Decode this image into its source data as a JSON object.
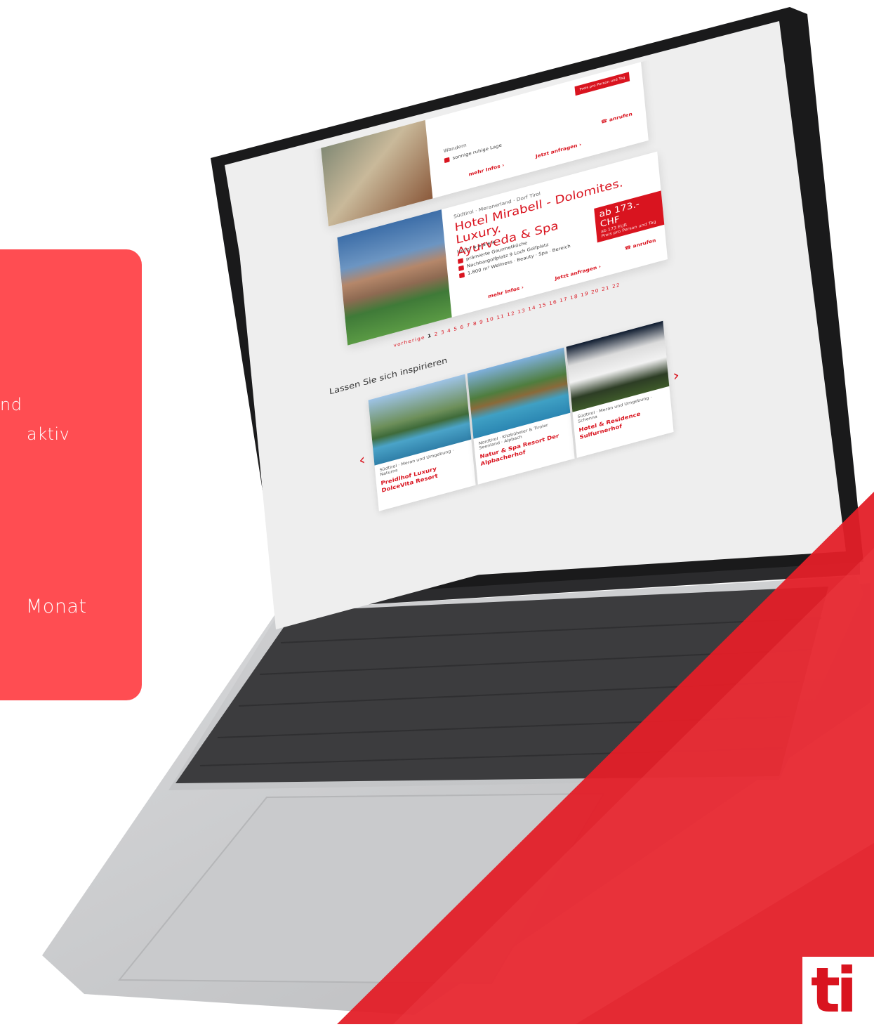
{
  "promo": {
    "line1": "nd",
    "line2": "aktiv",
    "line3": "Monat"
  },
  "laptop_screen": {
    "top_card": {
      "region_partial": "Wandern",
      "feature": "sonnige ruhige Lage",
      "price_note": "Preis pro Person und Tag",
      "more_link": "mehr Infos ›",
      "inquire_link": "Jetzt anfragen ›",
      "call_label": "anrufen"
    },
    "hotel_card": {
      "region": "Südtirol · Meranerland · Dorf Tirol",
      "title_line1": "Hotel Mirabell - Dolomites. Luxury.",
      "title_line2": "Ayurveda & Spa",
      "stars": "Hotel ★★★★★",
      "features": [
        "prämierte Gourmetküche",
        "Nachbargolfplatz 9 Loch Golfplatz",
        "1.800 m² Wellness · Beauty · Spa · Bereich"
      ],
      "price_main": "ab 173.- CHF",
      "price_sub": "ab 173 EUR",
      "price_note": "Preis pro Person und Tag",
      "more_link": "mehr Infos ›",
      "inquire_link": "Jetzt anfragen ›",
      "call_label": "anrufen"
    },
    "pagination": {
      "prev_label": "vorherige",
      "current": "1",
      "pages": "2 3 4 5 6 7 8 9 10 11 12 13 14 15 16 17 18 19 20 21 22"
    },
    "inspiration": {
      "title": "Lassen Sie sich inspirieren",
      "prev_arrow": "‹",
      "next_arrow": "›",
      "cards": [
        {
          "region": "Südtirol · Meran und Umgebung · Naturns",
          "name": "Preidlhof Luxury DolceVita Resort"
        },
        {
          "region": "Nordtirol · Kitzbüheler & Tiroler Seenland · Alpbach",
          "name": "Natur & Spa Resort Der Alpbacherhof"
        },
        {
          "region": "Südtirol · Meran und Umgebung · Schenna",
          "name": "Hotel & Residence Sulfurnerhof"
        }
      ]
    }
  },
  "logo": {
    "text": "ti"
  },
  "colors": {
    "brand_red": "#d9141f",
    "panel_red": "#ff4d52"
  }
}
